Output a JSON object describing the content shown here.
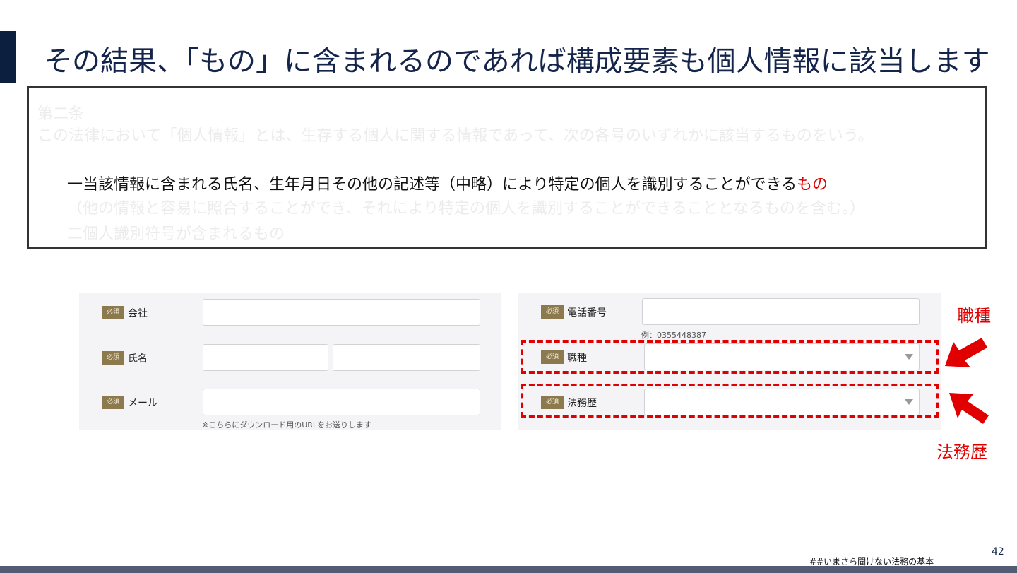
{
  "slide": {
    "title": "その結果、「もの」に含まれるのであれば構成要素も個人情報に該当します",
    "page_number": "42",
    "footer": "##いまさら聞けない法務の基本"
  },
  "article": {
    "heading": "第二条",
    "body": "この法律において「個人情報」とは、生存する個人に関する情報であって、次の各号のいずれかに該当するものをいう。",
    "item1_text": "一当該情報に含まれる氏名、生年月日その他の記述等（中略）により特定の個人を識別することができる",
    "item1_highlight": "もの",
    "item1_note": "（他の情報と容易に照合することができ、それにより特定の個人を識別することができることとなるものを含む。）",
    "item2": "二個人識別符号が含まれるもの"
  },
  "form": {
    "required_badge": "必須",
    "left": {
      "company_label": "会社",
      "name_label": "氏名",
      "email_label": "メール",
      "email_hint": "※こちらにダウンロード用のURLをお送りします"
    },
    "right": {
      "phone_label": "電話番号",
      "phone_hint": "例：0355448387",
      "job_label": "職種",
      "legal_exp_label": "法務歴"
    }
  },
  "annotations": {
    "job_callout": "職種",
    "legal_exp_callout": "法務歴",
    "highlight_color": "#e00000"
  },
  "colors": {
    "title": "#14244a",
    "accent_bar": "#0d1f3f",
    "badge": "#8c7a4e",
    "bottom_bar": "#525c74"
  }
}
